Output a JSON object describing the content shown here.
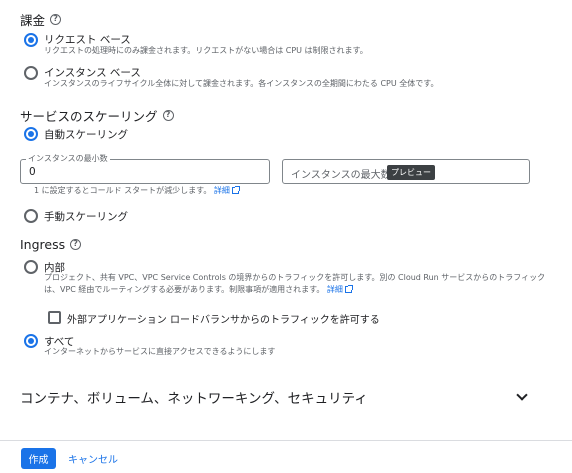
{
  "billing": {
    "title": "課金",
    "options": [
      {
        "label": "リクエスト ベース",
        "desc": "リクエストの処理時にのみ課金されます。リクエストがない場合は CPU は制限されます。",
        "selected": true
      },
      {
        "label": "インスタンス ベース",
        "desc": "インスタンスのライフサイクル全体に対して課金されます。各インスタンスの全期間にわたる CPU 全体です。",
        "selected": false
      }
    ]
  },
  "scaling": {
    "title": "サービスのスケーリング",
    "auto_label": "自動スケーリング",
    "min_instances": {
      "label": "インスタンスの最小数",
      "value": "0"
    },
    "max_instances": {
      "placeholder": "インスタンスの最大数",
      "badge": "プレビュー"
    },
    "hint": "1 に設定するとコールド スタートが減少します。",
    "hint_link": "詳細",
    "manual_label": "手動スケーリング"
  },
  "ingress": {
    "title": "Ingress",
    "internal_label": "内部",
    "internal_desc_line1": "プロジェクト、共有 VPC、VPC Service Controls の境界からのトラフィックを許可します。別の Cloud Run サービスからのトラフィック",
    "internal_desc_line2": "は、VPC 経由でルーティングする必要があります。制限事項が適用されます。",
    "internal_link": "詳細",
    "lb_checkbox_label": "外部アプリケーション ロードバランサからのトラフィックを許可する",
    "all_label": "すべて",
    "all_desc": "インターネットからサービスに直接アクセスできるようにします"
  },
  "expander": {
    "title": "コンテナ、ボリューム、ネットワーキング、セキュリティ"
  },
  "footer": {
    "create": "作成",
    "cancel": "キャンセル"
  },
  "colors": {
    "accent": "#1a73e8",
    "text": "#202124",
    "secondary": "#5f6368"
  }
}
